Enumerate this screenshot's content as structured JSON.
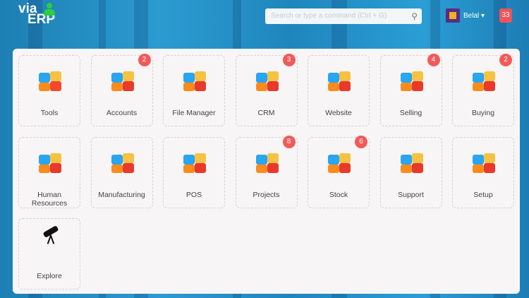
{
  "header": {
    "logo_line1": "via",
    "logo_line2": "ERP",
    "search_placeholder": "Search or type a command (Ctrl + G)",
    "user_name": "Belal ▾",
    "notification_count": "33"
  },
  "modules": [
    {
      "label": "Tools",
      "icon": "calendar-icon",
      "badge": null,
      "colors": [
        "#2aa5f0",
        "#f6c244",
        "#f2492c",
        "#fb8c1c"
      ]
    },
    {
      "label": "Accounts",
      "icon": "calculator-icon",
      "badge": "2",
      "colors": [
        "#2aa5f0",
        "#f6c244",
        "#e8392b",
        "#fb8c1c"
      ]
    },
    {
      "label": "File Manager",
      "icon": "clipboard-edit-icon",
      "badge": null,
      "colors": [
        "#2aa5f0",
        "#f6c244",
        "#e8392b",
        "#fb8c1c"
      ]
    },
    {
      "label": "CRM",
      "icon": "crm-cycle-icon",
      "badge": "3",
      "colors": [
        "#2aa5f0",
        "#f6c244",
        "#e8392b",
        "#fb8c1c"
      ]
    },
    {
      "label": "Website",
      "icon": "laptop-globe-icon",
      "badge": null,
      "colors": [
        "#2aa5f0",
        "#f6c244",
        "#e8392b",
        "#fb8c1c"
      ]
    },
    {
      "label": "Selling",
      "icon": "barcode-icon",
      "badge": "4",
      "colors": [
        "#2aa5f0",
        "#f6c244",
        "#e8392b",
        "#fb8c1c"
      ]
    },
    {
      "label": "Buying",
      "icon": "shopping-cart-icon",
      "badge": "2",
      "colors": [
        "#2aa5f0",
        "#f6c244",
        "#e8392b",
        "#fb8c1c"
      ]
    },
    {
      "label": "Human Resources",
      "icon": "tools-icon",
      "badge": null,
      "colors": [
        "#2aa5f0",
        "#f6c244",
        "#e8392b",
        "#fb8c1c"
      ]
    },
    {
      "label": "Manufacturing",
      "icon": "factory-icon",
      "badge": null,
      "colors": [
        "#2aa5f0",
        "#f6c244",
        "#e8392b",
        "#fb8c1c"
      ]
    },
    {
      "label": "POS",
      "icon": "cash-register-icon",
      "badge": null,
      "colors": [
        "#2aa5f0",
        "#f6c244",
        "#e8392b",
        "#fb8c1c"
      ]
    },
    {
      "label": "Projects",
      "icon": "gantt-icon",
      "badge": "8",
      "colors": [
        "#2aa5f0",
        "#f6c244",
        "#e8392b",
        "#fb8c1c"
      ]
    },
    {
      "label": "Stock",
      "icon": "forklift-icon",
      "badge": "6",
      "colors": [
        "#2aa5f0",
        "#f6c244",
        "#e8392b",
        "#fb8c1c"
      ]
    },
    {
      "label": "Support",
      "icon": "monitor-support-icon",
      "badge": null,
      "colors": [
        "#2aa5f0",
        "#f6c244",
        "#e8392b",
        "#fb8c1c"
      ]
    },
    {
      "label": "Setup",
      "icon": "sliders-icon",
      "badge": null,
      "colors": [
        "#2aa5f0",
        "#f6c244",
        "#e8392b",
        "#fb8c1c"
      ]
    },
    {
      "label": "Explore",
      "icon": "telescope-icon",
      "badge": null,
      "colors": [
        "#111111",
        "#111111",
        "#111111",
        "#111111"
      ]
    }
  ]
}
